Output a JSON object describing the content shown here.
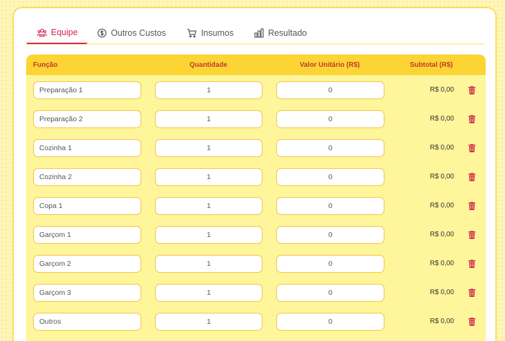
{
  "tabs": [
    {
      "label": "Equipe",
      "icon": "users-icon",
      "active": true
    },
    {
      "label": "Outros Custos",
      "icon": "dollar-circle-icon",
      "active": false
    },
    {
      "label": "Insumos",
      "icon": "cart-icon",
      "active": false
    },
    {
      "label": "Resultado",
      "icon": "bar-chart-icon",
      "active": false
    }
  ],
  "table": {
    "headers": {
      "funcao": "Função",
      "quantidade": "Quantidade",
      "valor_unitario": "Valor Unitário (R$)",
      "subtotal": "Subtotal (R$)"
    },
    "rows": [
      {
        "funcao": "Preparação 1",
        "quantidade": "1",
        "valor": "0",
        "subtotal": "R$ 0,00"
      },
      {
        "funcao": "Preparação 2",
        "quantidade": "1",
        "valor": "0",
        "subtotal": "R$ 0,00"
      },
      {
        "funcao": "Cozinha 1",
        "quantidade": "1",
        "valor": "0",
        "subtotal": "R$ 0,00"
      },
      {
        "funcao": "Cozinha 2",
        "quantidade": "1",
        "valor": "0",
        "subtotal": "R$ 0,00"
      },
      {
        "funcao": "Copa 1",
        "quantidade": "1",
        "valor": "0",
        "subtotal": "R$ 0,00"
      },
      {
        "funcao": "Garçom 1",
        "quantidade": "1",
        "valor": "0",
        "subtotal": "R$ 0,00"
      },
      {
        "funcao": "Garçom 2",
        "quantidade": "1",
        "valor": "0",
        "subtotal": "R$ 0,00"
      },
      {
        "funcao": "Garçom 3",
        "quantidade": "1",
        "valor": "0",
        "subtotal": "R$ 0,00"
      },
      {
        "funcao": "Outros",
        "quantidade": "1",
        "valor": "0",
        "subtotal": "R$ 0,00"
      }
    ]
  },
  "colors": {
    "accent": "#d4264a",
    "header_bg": "#fcd535",
    "panel_bg": "#fff59a",
    "footer_bar": "#f39a1c",
    "delete_icon": "#d4264a"
  }
}
